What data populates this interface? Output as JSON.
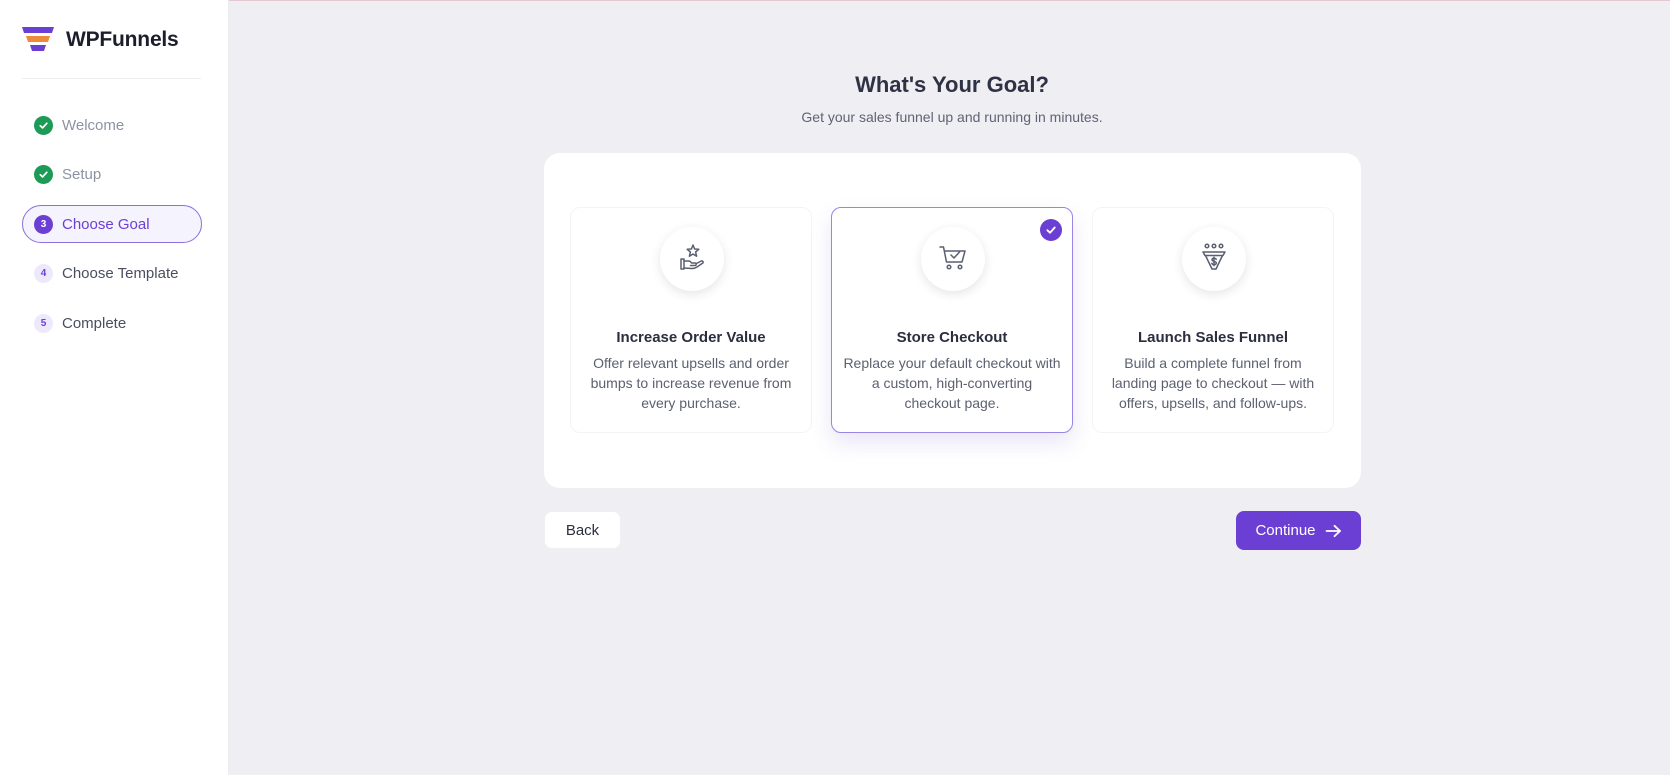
{
  "app": {
    "name": "WPFunnels"
  },
  "sidebar": {
    "steps": [
      {
        "label": "Welcome",
        "marker": "",
        "state": "done"
      },
      {
        "label": "Setup",
        "marker": "",
        "state": "done"
      },
      {
        "label": "Choose Goal",
        "marker": "3",
        "state": "active"
      },
      {
        "label": "Choose Template",
        "marker": "4",
        "state": "todo"
      },
      {
        "label": "Complete",
        "marker": "5",
        "state": "todo"
      }
    ]
  },
  "main": {
    "title": "What's Your Goal?",
    "subtitle": "Get your sales funnel up and running in minutes.",
    "cards": [
      {
        "title": "Increase Order Value",
        "description": "Offer relevant upsells and order bumps to increase revenue from every purchase.",
        "icon": "hand-star-icon",
        "selected": false
      },
      {
        "title": "Store Checkout",
        "description": "Replace your default checkout with a custom, high-converting checkout page.",
        "icon": "cart-check-icon",
        "selected": true
      },
      {
        "title": "Launch Sales Funnel",
        "description": "Build a complete funnel from landing page to checkout — with offers, upsells, and follow-ups.",
        "icon": "funnel-dollar-icon",
        "selected": false
      }
    ]
  },
  "actions": {
    "back_label": "Back",
    "continue_label": "Continue"
  },
  "colors": {
    "accent": "#6c3fd4",
    "done": "#1d9a55",
    "background": "#efeef2"
  }
}
